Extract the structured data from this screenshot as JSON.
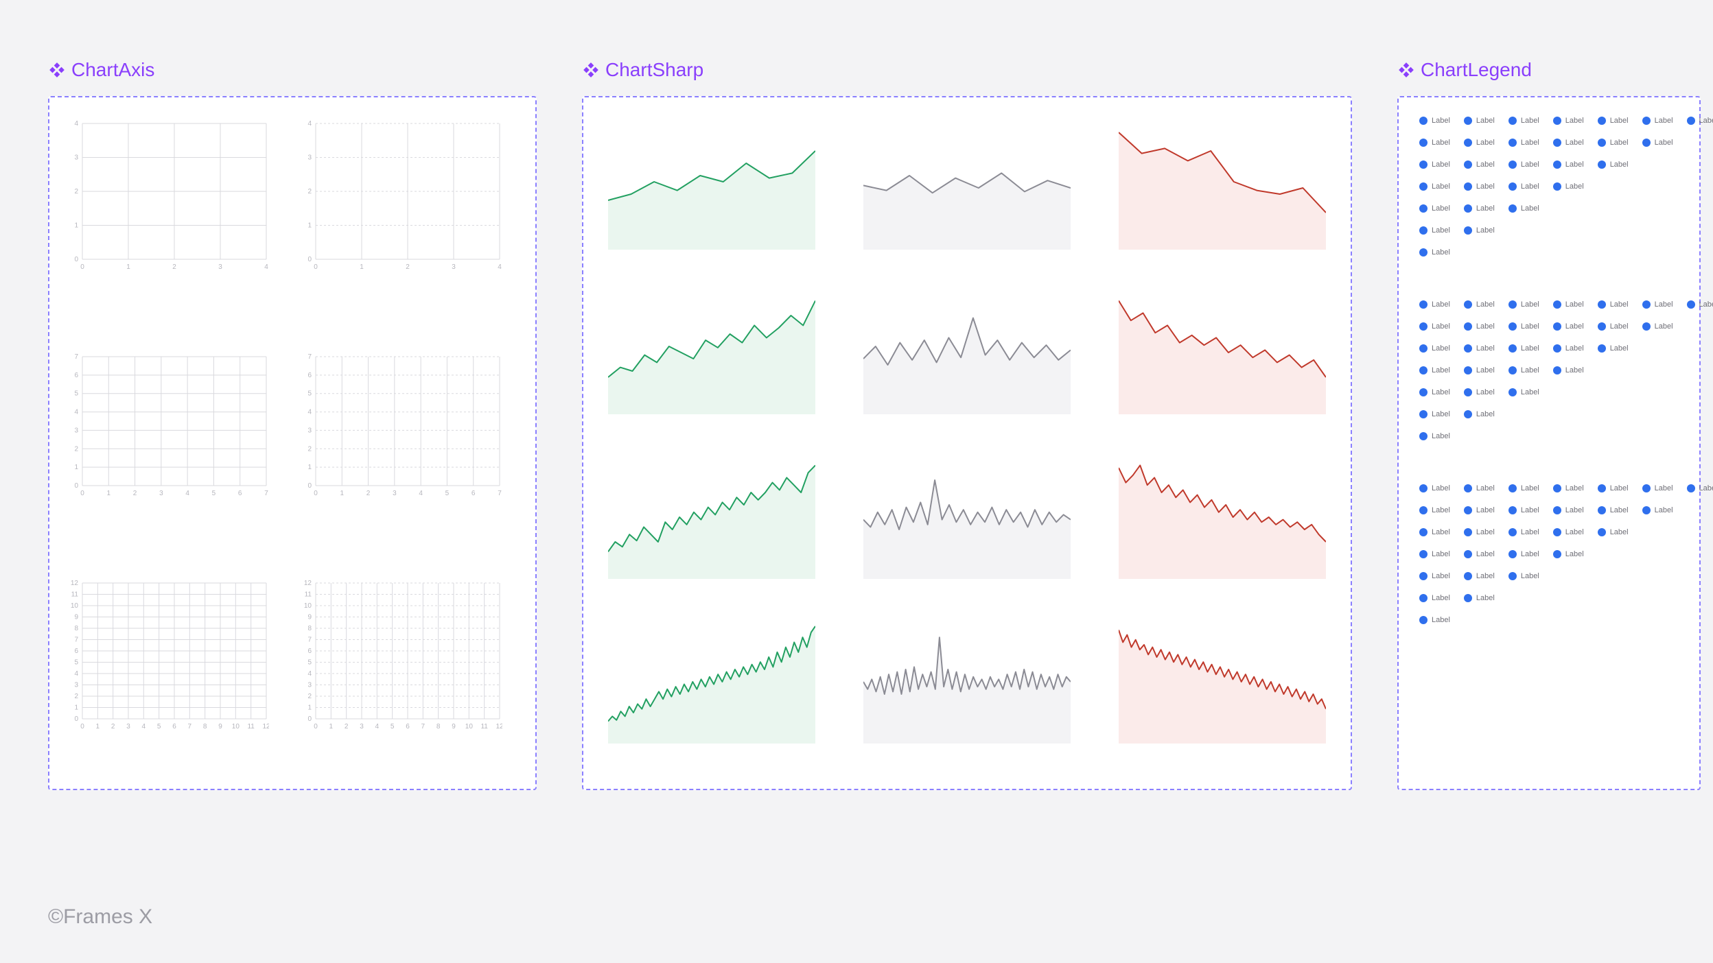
{
  "components": {
    "axis": {
      "title": "ChartAxis"
    },
    "sharp": {
      "title": "ChartSharp"
    },
    "legend": {
      "title": "ChartLegend"
    }
  },
  "legend_item_label": "Label",
  "legend_blocks": [
    [
      7,
      6,
      5,
      4,
      3,
      2,
      1
    ],
    [
      7,
      6,
      5,
      4,
      3,
      2,
      1
    ],
    [
      7,
      6,
      5,
      4,
      3,
      2,
      1
    ]
  ],
  "footer": "©Frames X",
  "chart_data": {
    "axis_variants": [
      {
        "xticks": [
          0,
          1,
          2,
          3,
          4
        ],
        "yticks": [
          0,
          1,
          2,
          3,
          4
        ],
        "dashed_horizontal": false
      },
      {
        "xticks": [
          0,
          1,
          2,
          3,
          4
        ],
        "yticks": [
          0,
          1,
          2,
          3,
          4
        ],
        "dashed_horizontal": true
      },
      {
        "xticks": [
          0,
          1,
          2,
          3,
          4,
          5,
          6,
          7
        ],
        "yticks": [
          0,
          1,
          2,
          3,
          4,
          5,
          6,
          7
        ],
        "dashed_horizontal": false
      },
      {
        "xticks": [
          0,
          1,
          2,
          3,
          4,
          5,
          6,
          7
        ],
        "yticks": [
          0,
          1,
          2,
          3,
          4,
          5,
          6,
          7
        ],
        "dashed_horizontal": true
      },
      {
        "xticks": [
          0,
          1,
          2,
          3,
          4,
          5,
          6,
          7,
          8,
          9,
          10,
          11,
          12
        ],
        "yticks": [
          0,
          1,
          2,
          3,
          4,
          5,
          6,
          7,
          8,
          9,
          10,
          11,
          12
        ],
        "dashed_horizontal": false
      },
      {
        "xticks": [
          0,
          1,
          2,
          3,
          4,
          5,
          6,
          7,
          8,
          9,
          10,
          11,
          12
        ],
        "yticks": [
          0,
          1,
          2,
          3,
          4,
          5,
          6,
          7,
          8,
          9,
          10,
          11,
          12
        ],
        "dashed_horizontal": true
      }
    ],
    "sharp_rows": [
      {
        "points": 10,
        "series": [
          {
            "kind": "up",
            "color": "#22a061",
            "fill": "#eaf6ef",
            "values": [
              0.4,
              0.45,
              0.55,
              0.48,
              0.6,
              0.55,
              0.7,
              0.58,
              0.62,
              0.8
            ]
          },
          {
            "kind": "flat",
            "color": "#8b8b94",
            "fill": "#f3f3f5",
            "values": [
              0.52,
              0.48,
              0.6,
              0.46,
              0.58,
              0.5,
              0.62,
              0.47,
              0.56,
              0.5
            ]
          },
          {
            "kind": "down",
            "color": "#c0392b",
            "fill": "#fbebea",
            "values": [
              0.95,
              0.78,
              0.82,
              0.72,
              0.8,
              0.55,
              0.48,
              0.45,
              0.5,
              0.3
            ]
          }
        ]
      },
      {
        "points": 18,
        "series": [
          {
            "kind": "up",
            "color": "#22a061",
            "fill": "#eaf6ef",
            "values": [
              0.3,
              0.38,
              0.35,
              0.48,
              0.42,
              0.55,
              0.5,
              0.45,
              0.6,
              0.54,
              0.65,
              0.58,
              0.72,
              0.62,
              0.7,
              0.8,
              0.72,
              0.92
            ]
          },
          {
            "kind": "flat",
            "color": "#8b8b94",
            "fill": "#f3f3f5",
            "values": [
              0.45,
              0.55,
              0.4,
              0.58,
              0.44,
              0.6,
              0.42,
              0.62,
              0.46,
              0.78,
              0.48,
              0.6,
              0.44,
              0.58,
              0.46,
              0.56,
              0.44,
              0.52
            ]
          },
          {
            "kind": "down",
            "color": "#c0392b",
            "fill": "#fbebea",
            "values": [
              0.92,
              0.76,
              0.82,
              0.66,
              0.72,
              0.58,
              0.64,
              0.56,
              0.62,
              0.5,
              0.56,
              0.46,
              0.52,
              0.42,
              0.48,
              0.38,
              0.44,
              0.3
            ]
          }
        ]
      },
      {
        "points": 30,
        "series": [
          {
            "kind": "up",
            "color": "#22a061",
            "fill": "#eaf6ef",
            "values": [
              0.22,
              0.3,
              0.26,
              0.36,
              0.31,
              0.42,
              0.36,
              0.3,
              0.46,
              0.4,
              0.5,
              0.44,
              0.54,
              0.48,
              0.58,
              0.52,
              0.62,
              0.56,
              0.66,
              0.6,
              0.7,
              0.64,
              0.7,
              0.78,
              0.72,
              0.82,
              0.76,
              0.7,
              0.86,
              0.92
            ]
          },
          {
            "kind": "flat",
            "color": "#8b8b94",
            "fill": "#f3f3f5",
            "values": [
              0.48,
              0.42,
              0.54,
              0.44,
              0.56,
              0.4,
              0.58,
              0.46,
              0.62,
              0.44,
              0.8,
              0.48,
              0.6,
              0.46,
              0.56,
              0.44,
              0.54,
              0.46,
              0.58,
              0.44,
              0.56,
              0.46,
              0.54,
              0.42,
              0.56,
              0.44,
              0.54,
              0.46,
              0.52,
              0.48
            ]
          },
          {
            "kind": "down",
            "color": "#c0392b",
            "fill": "#fbebea",
            "values": [
              0.9,
              0.78,
              0.84,
              0.92,
              0.76,
              0.82,
              0.7,
              0.76,
              0.66,
              0.72,
              0.62,
              0.68,
              0.58,
              0.64,
              0.54,
              0.6,
              0.5,
              0.56,
              0.48,
              0.54,
              0.46,
              0.5,
              0.44,
              0.48,
              0.42,
              0.46,
              0.4,
              0.44,
              0.36,
              0.3
            ]
          }
        ]
      },
      {
        "points": 50,
        "series": [
          {
            "kind": "up",
            "color": "#22a061",
            "fill": "#eaf6ef",
            "values": [
              0.18,
              0.22,
              0.19,
              0.26,
              0.22,
              0.3,
              0.25,
              0.32,
              0.28,
              0.36,
              0.3,
              0.36,
              0.42,
              0.36,
              0.44,
              0.38,
              0.46,
              0.4,
              0.48,
              0.42,
              0.5,
              0.44,
              0.52,
              0.46,
              0.54,
              0.48,
              0.56,
              0.5,
              0.58,
              0.52,
              0.6,
              0.54,
              0.62,
              0.56,
              0.64,
              0.58,
              0.66,
              0.6,
              0.7,
              0.62,
              0.74,
              0.66,
              0.78,
              0.7,
              0.82,
              0.74,
              0.86,
              0.78,
              0.9,
              0.95
            ]
          },
          {
            "kind": "flat",
            "color": "#8b8b94",
            "fill": "#f3f3f5",
            "values": [
              0.5,
              0.44,
              0.52,
              0.42,
              0.54,
              0.4,
              0.56,
              0.42,
              0.58,
              0.4,
              0.6,
              0.42,
              0.62,
              0.44,
              0.56,
              0.46,
              0.58,
              0.44,
              0.86,
              0.46,
              0.6,
              0.44,
              0.58,
              0.42,
              0.56,
              0.44,
              0.54,
              0.46,
              0.52,
              0.44,
              0.54,
              0.46,
              0.52,
              0.44,
              0.56,
              0.46,
              0.58,
              0.44,
              0.6,
              0.46,
              0.58,
              0.44,
              0.56,
              0.46,
              0.54,
              0.44,
              0.56,
              0.46,
              0.54,
              0.5
            ]
          },
          {
            "kind": "down",
            "color": "#c0392b",
            "fill": "#fbebea",
            "values": [
              0.92,
              0.82,
              0.88,
              0.78,
              0.84,
              0.76,
              0.8,
              0.72,
              0.78,
              0.7,
              0.76,
              0.68,
              0.74,
              0.66,
              0.72,
              0.64,
              0.7,
              0.62,
              0.68,
              0.6,
              0.66,
              0.58,
              0.64,
              0.56,
              0.62,
              0.54,
              0.6,
              0.52,
              0.58,
              0.5,
              0.56,
              0.48,
              0.54,
              0.46,
              0.52,
              0.44,
              0.5,
              0.42,
              0.48,
              0.4,
              0.46,
              0.38,
              0.44,
              0.36,
              0.42,
              0.34,
              0.4,
              0.32,
              0.36,
              0.28
            ]
          }
        ]
      }
    ]
  }
}
